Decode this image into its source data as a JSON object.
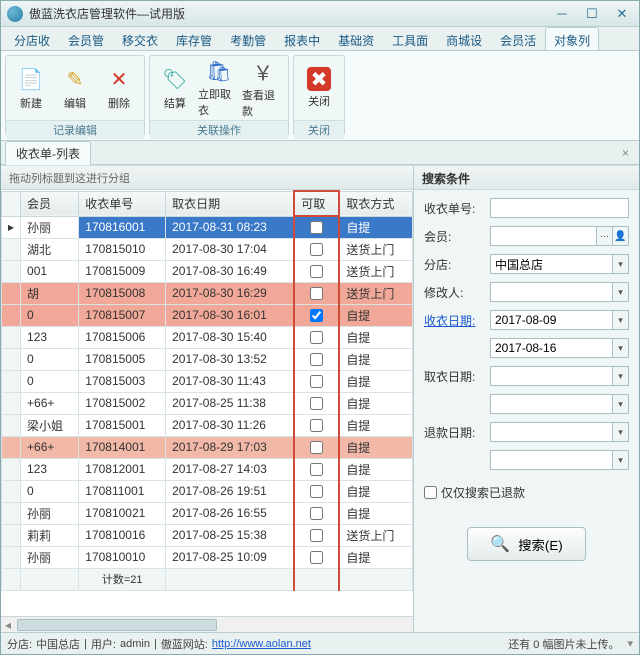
{
  "window": {
    "title": "傲蓝洗衣店管理软件—试用版"
  },
  "menu": [
    "分店收",
    "会员管",
    "移交衣",
    "库存管",
    "考勤管",
    "报表中",
    "基础资",
    "工具面",
    "商城设",
    "会员活",
    "对象列"
  ],
  "menu_active": 10,
  "ribbon": {
    "groups": [
      {
        "label": "记录编辑",
        "buttons": [
          {
            "icon": "📄",
            "color": "#3a9d3a",
            "label": "新建"
          },
          {
            "icon": "✎",
            "color": "#d4a82a",
            "label": "编辑"
          },
          {
            "icon": "✕",
            "color": "#d23a2a",
            "label": "删除"
          }
        ]
      },
      {
        "label": "关联操作",
        "buttons": [
          {
            "icon": "🏷",
            "color": "#2aa898",
            "label": "结算"
          },
          {
            "icon": "🛍",
            "color": "#2a68c8",
            "label": "立即取衣"
          },
          {
            "icon": "￥",
            "color": "#555",
            "label": "查看退款"
          }
        ]
      },
      {
        "label": "关闭",
        "buttons": [
          {
            "icon": "✖",
            "color": "#fff",
            "bg": "#d23a2a",
            "label": "关闭"
          }
        ]
      }
    ]
  },
  "tab": {
    "title": "收衣单-列表"
  },
  "grid": {
    "group_hint": "拖动列标题到这进行分组",
    "columns": [
      "会员",
      "收衣单号",
      "取衣日期",
      "可取",
      "取衣方式"
    ],
    "rows": [
      {
        "member": "孙丽",
        "no": "170816001",
        "date": "2017-08-31 08:23",
        "chk": false,
        "mode": "自提",
        "sel": true
      },
      {
        "member": "湖北",
        "no": "170815010",
        "date": "2017-08-30 17:04",
        "chk": false,
        "mode": "送货上门"
      },
      {
        "member": "001",
        "no": "170815009",
        "date": "2017-08-30 16:49",
        "chk": false,
        "mode": "送货上门"
      },
      {
        "member": "胡",
        "no": "170815008",
        "date": "2017-08-30 16:29",
        "chk": false,
        "mode": "送货上门",
        "hl": true
      },
      {
        "member": "0",
        "no": "170815007",
        "date": "2017-08-30 16:01",
        "chk": true,
        "mode": "自提",
        "hl": true
      },
      {
        "member": "123",
        "no": "170815006",
        "date": "2017-08-30 15:40",
        "chk": false,
        "mode": "自提"
      },
      {
        "member": "0",
        "no": "170815005",
        "date": "2017-08-30 13:52",
        "chk": false,
        "mode": "自提"
      },
      {
        "member": "0",
        "no": "170815003",
        "date": "2017-08-30 11:43",
        "chk": false,
        "mode": "自提"
      },
      {
        "member": "+66+",
        "no": "170815002",
        "date": "2017-08-25 11:38",
        "chk": false,
        "mode": "自提"
      },
      {
        "member": "梁小姐",
        "no": "170815001",
        "date": "2017-08-30 11:26",
        "chk": false,
        "mode": "自提"
      },
      {
        "member": "+66+",
        "no": "170814001",
        "date": "2017-08-29 17:03",
        "chk": false,
        "mode": "自提",
        "hl2": true
      },
      {
        "member": "123",
        "no": "170812001",
        "date": "2017-08-27 14:03",
        "chk": false,
        "mode": "自提"
      },
      {
        "member": "0",
        "no": "170811001",
        "date": "2017-08-26 19:51",
        "chk": false,
        "mode": "自提"
      },
      {
        "member": "孙丽",
        "no": "170810021",
        "date": "2017-08-26 16:55",
        "chk": false,
        "mode": "自提"
      },
      {
        "member": "莉莉",
        "no": "170810016",
        "date": "2017-08-25 15:38",
        "chk": false,
        "mode": "送货上门"
      },
      {
        "member": "孙丽",
        "no": "170810010",
        "date": "2017-08-25 10:09",
        "chk": false,
        "mode": "自提"
      }
    ],
    "footer": "计数=21"
  },
  "search": {
    "title": "搜索条件",
    "fields": {
      "order_label": "收衣单号:",
      "order": "",
      "member_label": "会员:",
      "member": "",
      "store_label": "分店:",
      "store": "中国总店",
      "modifier_label": "修改人:",
      "modifier": "",
      "recv_date_label": "收衣日期:",
      "recv_date1": "2017-08-09",
      "recv_date2": "2017-08-16",
      "pick_date_label": "取衣日期:",
      "pick_date1": "",
      "pick_date2": "",
      "refund_date_label": "退款日期:",
      "refund_date1": "",
      "refund_date2": "",
      "only_refund_label": "仅仅搜索已退款",
      "search_btn": "搜索(E)"
    }
  },
  "status": {
    "store_label": "分店:",
    "store": "中国总店",
    "user_label": "用户:",
    "user": "admin",
    "site_label": "傲蓝网站:",
    "site_url": "http://www.aolan.net",
    "right": "还有 0 幅图片未上传。"
  }
}
